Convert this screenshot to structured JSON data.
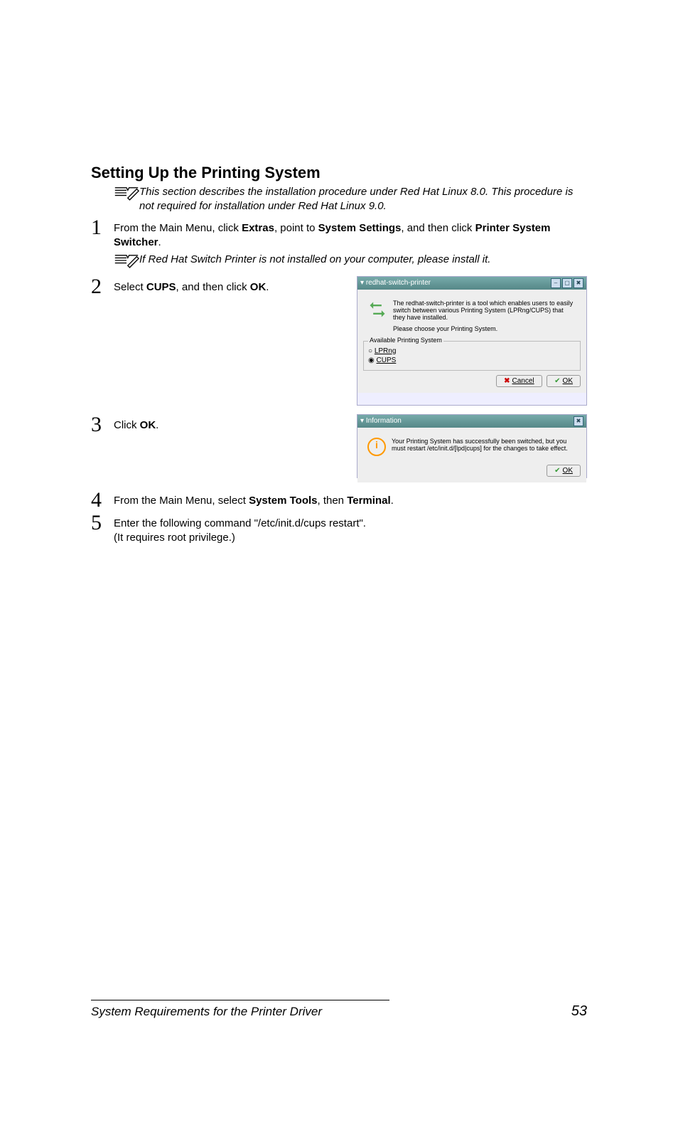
{
  "heading": "Setting Up the Printing System",
  "note1": "This section describes the installation procedure under Red Hat Linux 8.0. This procedure is not required for installation under Red Hat Linux 9.0.",
  "note2": "If Red Hat Switch Printer is not installed on your computer, please install it.",
  "step1": {
    "num": "1",
    "text_a": "From the Main Menu, click ",
    "b1": "Extras",
    "text_b": ", point to ",
    "b2": "System Settings",
    "text_c": ", and then click ",
    "b3": "Printer System Switcher",
    "text_d": "."
  },
  "step2": {
    "num": "2",
    "text_a": "Select ",
    "b1": "CUPS",
    "text_b": ", and then click ",
    "b2": "OK",
    "text_c": "."
  },
  "step3": {
    "num": "3",
    "text_a": "Click ",
    "b1": "OK",
    "text_b": "."
  },
  "step4": {
    "num": "4",
    "text_a": "From the Main Menu, select ",
    "b1": "System Tools",
    "text_b": ", then ",
    "b2": "Terminal",
    "text_c": "."
  },
  "step5": {
    "num": "5",
    "text_a": "Enter the following command \"/etc/init.d/cups restart\".",
    "line2": "(It requires root privilege.)"
  },
  "shot1": {
    "title": "redhat-switch-printer",
    "intro": "The redhat-switch-printer is a tool which enables users to easily switch between various Printing System (LPRng/CUPS) that they have installed.",
    "prompt": "Please choose your Printing System.",
    "group": "Available Printing System",
    "opt1": "LPRng",
    "opt2": "CUPS",
    "cancel": "Cancel",
    "ok": "OK"
  },
  "shot2": {
    "title": "Information",
    "msg": "Your Printing System has successfully been switched, but you must restart /etc/init.d/[lpd|cups] for the changes to take effect.",
    "ok": "OK"
  },
  "footer": {
    "title": "System Requirements for the Printer Driver",
    "page": "53"
  },
  "icons": {
    "minus": "–",
    "square": "▢",
    "x": "✖",
    "cancel": "✖",
    "ok": "✔",
    "chev": "▾"
  }
}
